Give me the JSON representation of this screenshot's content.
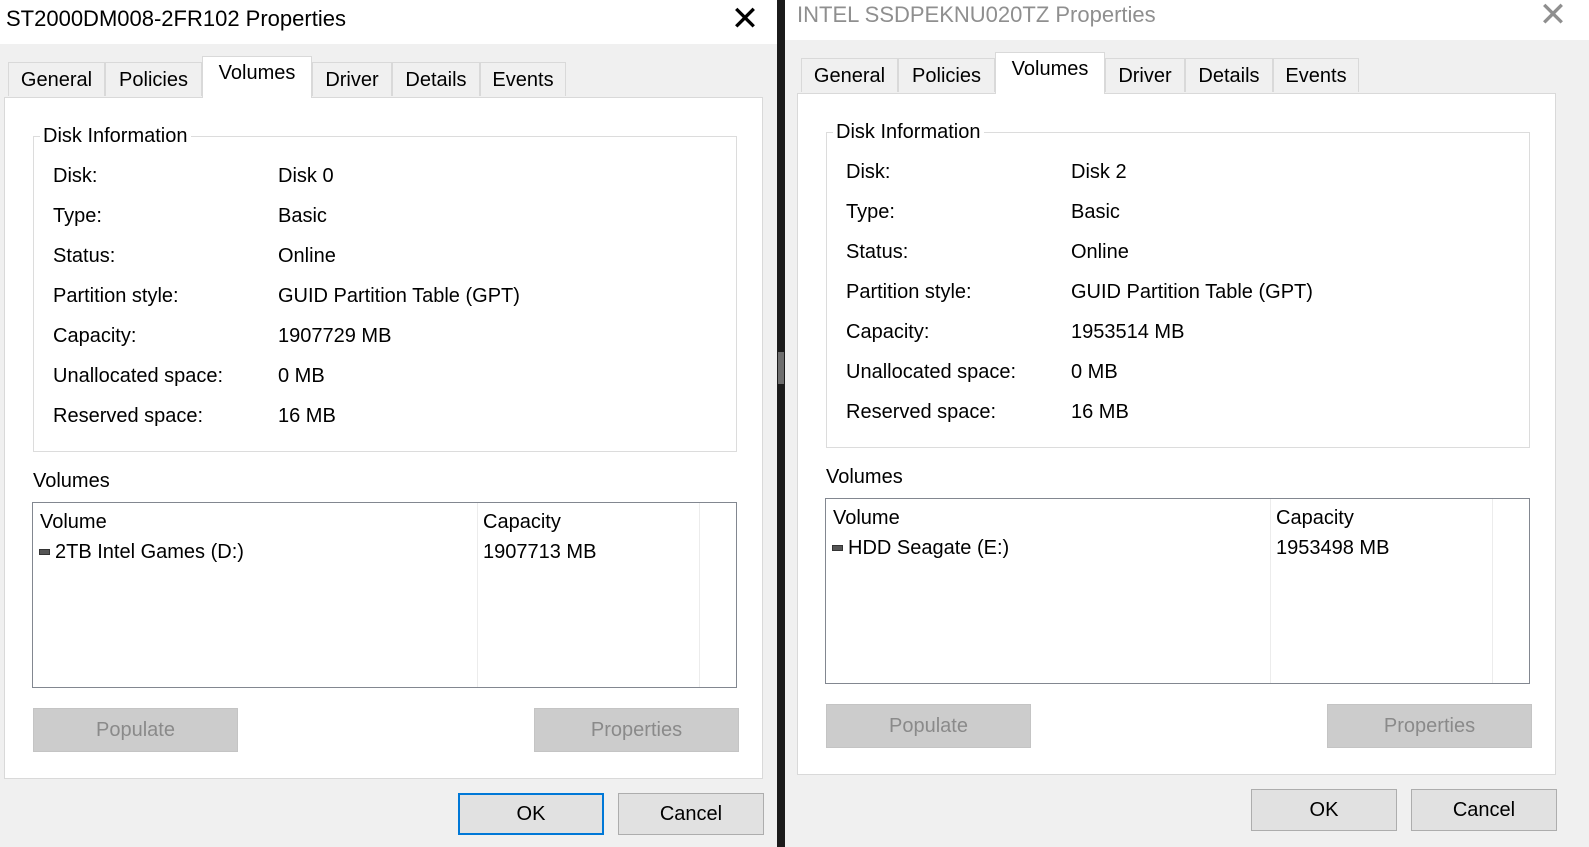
{
  "dialogs": [
    {
      "title": "ST2000DM008-2FR102 Properties",
      "close_glyph": "✕",
      "tabs": [
        "General",
        "Policies",
        "Volumes",
        "Driver",
        "Details",
        "Events"
      ],
      "active_tab": "Volumes",
      "disk_info": {
        "group_title": "Disk Information",
        "rows": [
          {
            "label": "Disk:",
            "value": "Disk 0"
          },
          {
            "label": "Type:",
            "value": "Basic"
          },
          {
            "label": "Status:",
            "value": "Online"
          },
          {
            "label": "Partition style:",
            "value": "GUID Partition Table (GPT)"
          },
          {
            "label": "Capacity:",
            "value": "1907729 MB"
          },
          {
            "label": "Unallocated space:",
            "value": "0 MB"
          },
          {
            "label": "Reserved space:",
            "value": "16 MB"
          }
        ]
      },
      "volumes": {
        "label": "Volumes",
        "columns": [
          "Volume",
          "Capacity"
        ],
        "rows": [
          {
            "icon": "drive-icon",
            "name": "2TB Intel Games (D:)",
            "capacity": "1907713 MB"
          }
        ]
      },
      "buttons": {
        "populate": "Populate",
        "properties": "Properties",
        "ok": "OK",
        "cancel": "Cancel"
      }
    },
    {
      "title": "INTEL SSDPEKNU020TZ Properties",
      "close_glyph": "✕",
      "tabs": [
        "General",
        "Policies",
        "Volumes",
        "Driver",
        "Details",
        "Events"
      ],
      "active_tab": "Volumes",
      "disk_info": {
        "group_title": "Disk Information",
        "rows": [
          {
            "label": "Disk:",
            "value": "Disk 2"
          },
          {
            "label": "Type:",
            "value": "Basic"
          },
          {
            "label": "Status:",
            "value": "Online"
          },
          {
            "label": "Partition style:",
            "value": "GUID Partition Table (GPT)"
          },
          {
            "label": "Capacity:",
            "value": "1953514 MB"
          },
          {
            "label": "Unallocated space:",
            "value": "0 MB"
          },
          {
            "label": "Reserved space:",
            "value": "16 MB"
          }
        ]
      },
      "volumes": {
        "label": "Volumes",
        "columns": [
          "Volume",
          "Capacity"
        ],
        "rows": [
          {
            "icon": "drive-icon",
            "name": "HDD Seagate (E:)",
            "capacity": "1953498 MB"
          }
        ]
      },
      "buttons": {
        "populate": "Populate",
        "properties": "Properties",
        "ok": "OK",
        "cancel": "Cancel"
      }
    }
  ],
  "colors": {
    "dialog_bg": "#f0f0f0",
    "panel_bg": "#ffffff",
    "accent_border": "#0078d7",
    "disabled_text": "#8a8a8a"
  }
}
